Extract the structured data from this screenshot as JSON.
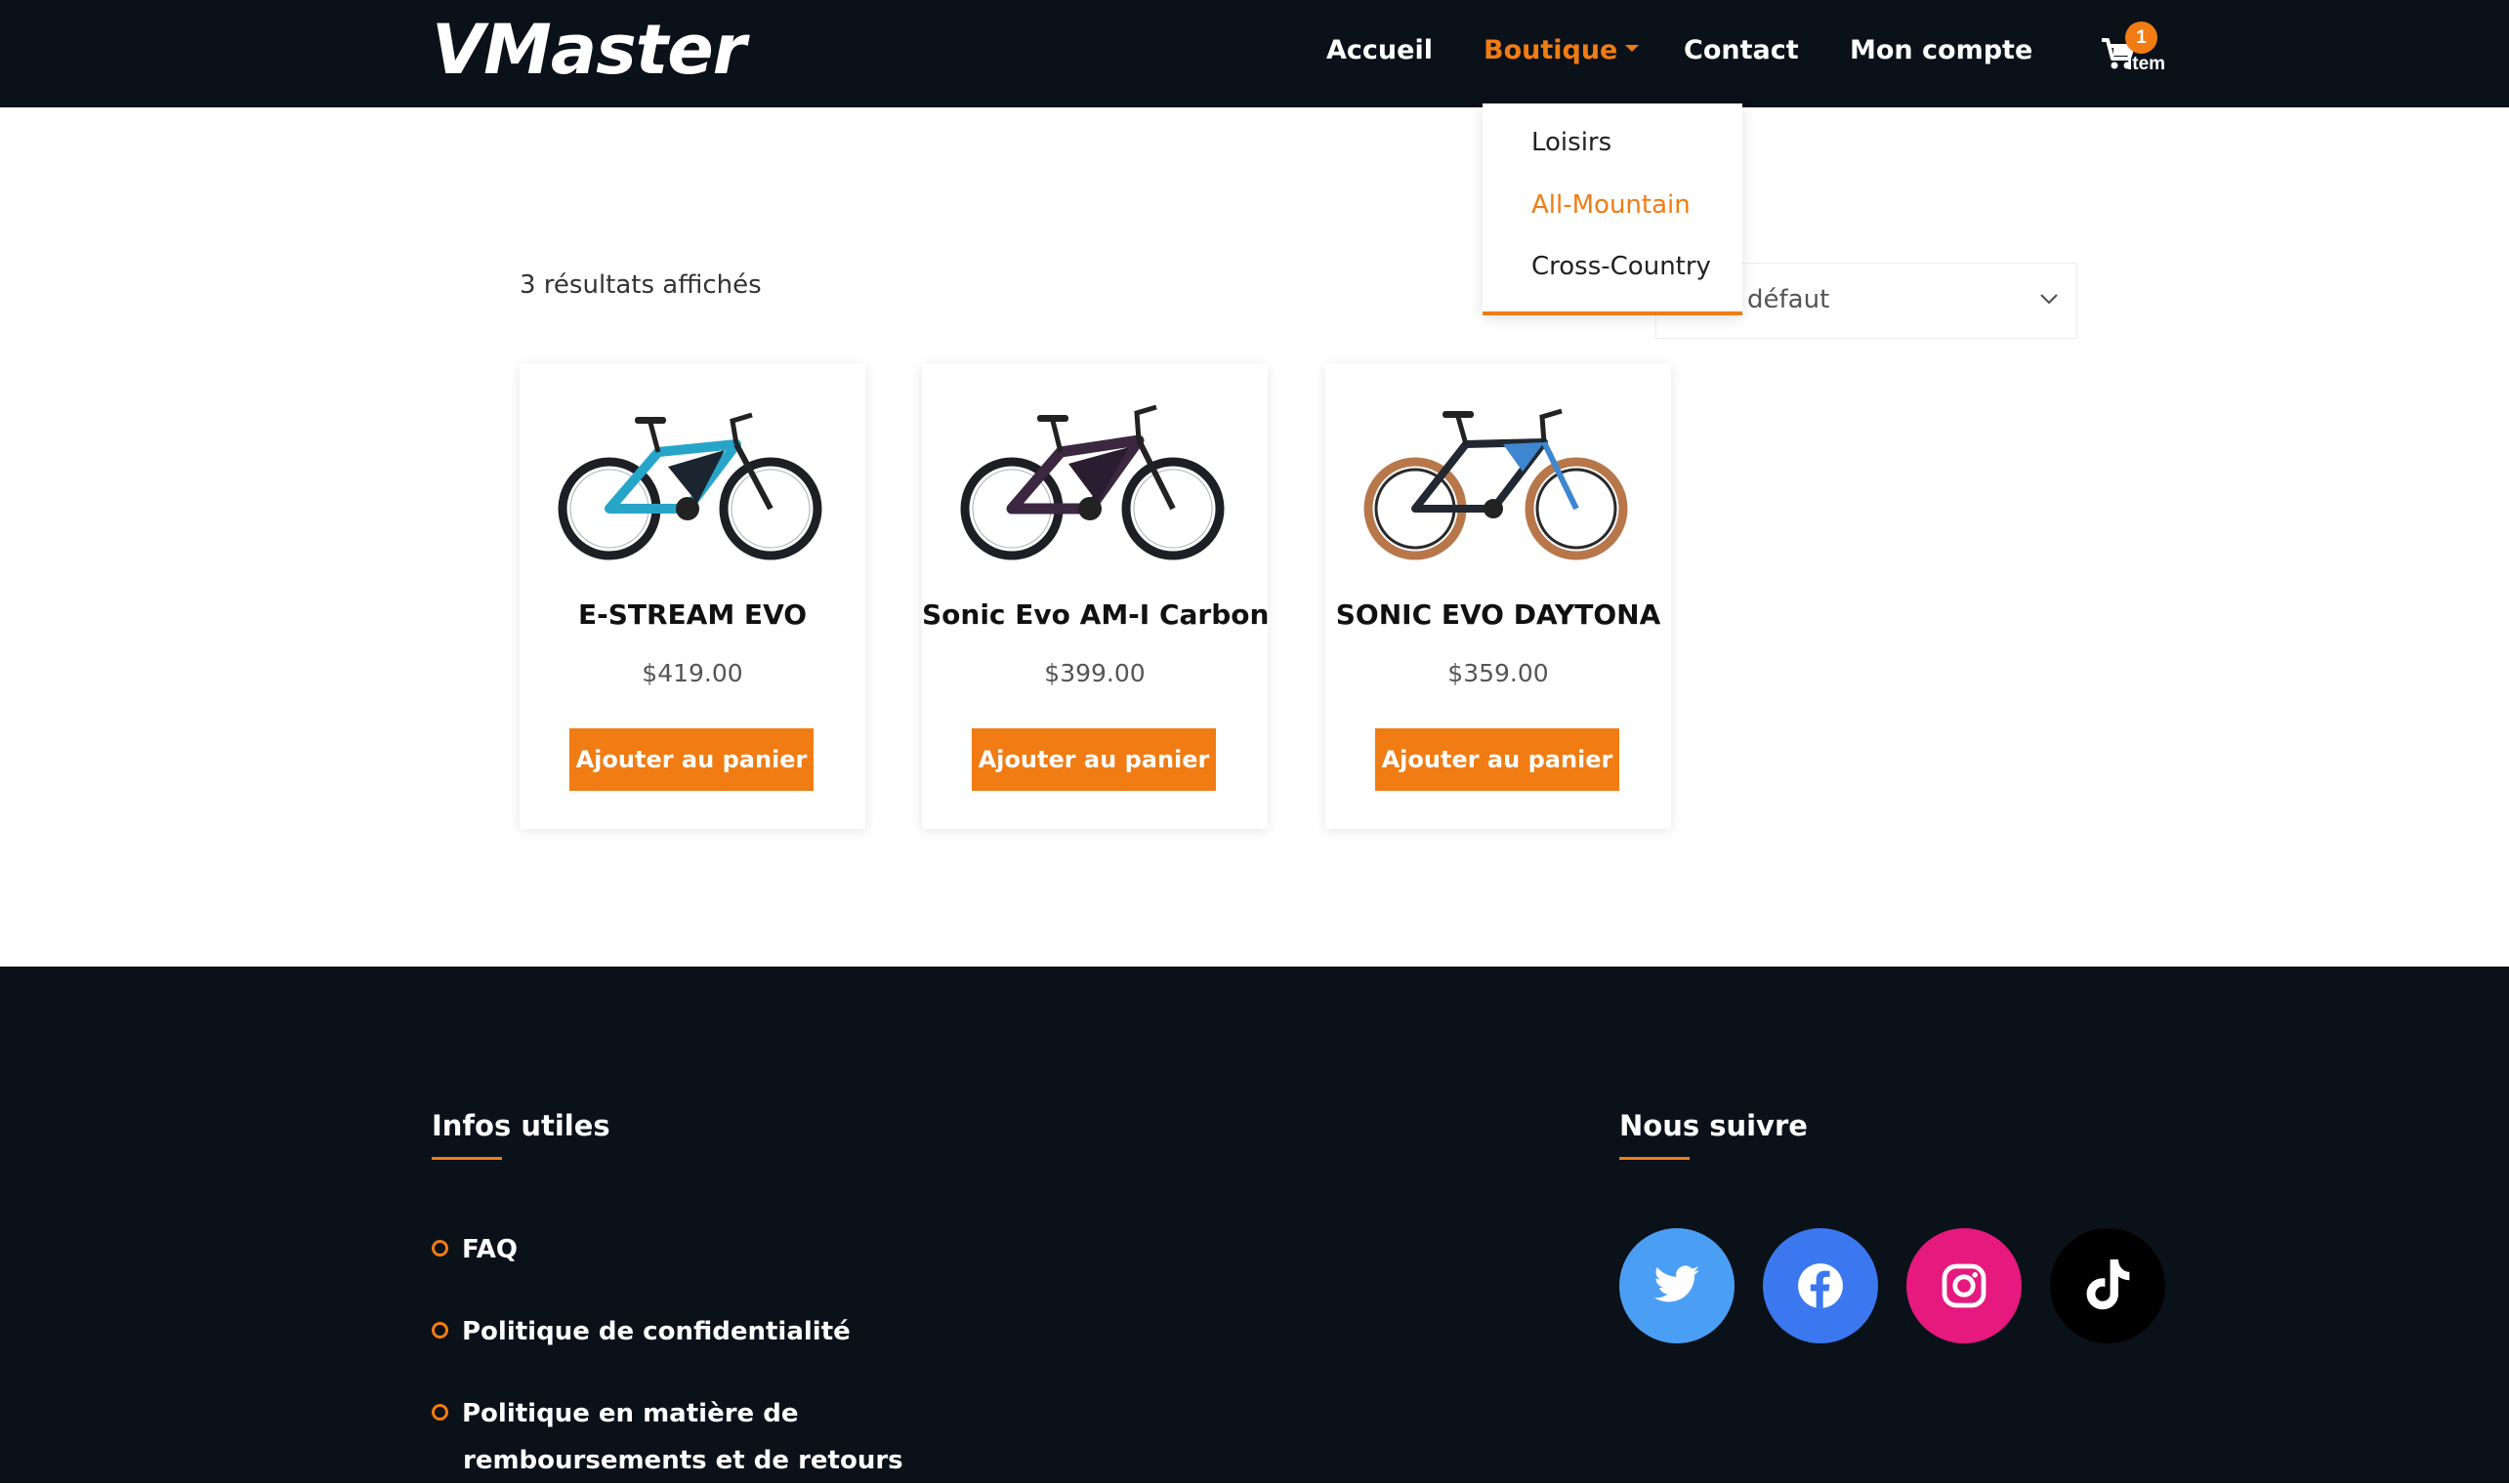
{
  "header": {
    "logo": "VMaster",
    "nav": [
      {
        "label": "Accueil"
      },
      {
        "label": "Boutique"
      },
      {
        "label": "Contact"
      },
      {
        "label": "Mon compte"
      }
    ],
    "cart": {
      "count": "1",
      "label": "Item"
    }
  },
  "dropdown": {
    "items": [
      {
        "label": "Loisirs"
      },
      {
        "label": "All-Mountain"
      },
      {
        "label": "Cross-Country"
      }
    ]
  },
  "shop": {
    "result_count": "3 résultats affichés",
    "sort_value": "défaut",
    "products": [
      {
        "title": "E-STREAM EVO",
        "price": "$419.00",
        "button": "Ajouter au panier"
      },
      {
        "title": "Sonic Evo AM-I Carbon",
        "price": "$399.00",
        "button": "Ajouter au panier"
      },
      {
        "title": "SONIC EVO DAYTONA",
        "price": "$359.00",
        "button": "Ajouter au panier"
      }
    ]
  },
  "footer": {
    "info_heading": "Infos utiles",
    "links": [
      {
        "label": "FAQ"
      },
      {
        "label": "Politique de confidentialité"
      },
      {
        "line1": "Politique en matière de",
        "line2": "remboursements et de retours"
      }
    ],
    "social_heading": "Nous suivre",
    "social": [
      {
        "icon": "twitter-icon",
        "color": "#4a9ff5"
      },
      {
        "icon": "facebook-icon",
        "color": "#3b78f0"
      },
      {
        "icon": "instagram-icon",
        "color": "#e6197e"
      },
      {
        "icon": "tiktok-icon",
        "color": "#000000"
      }
    ]
  },
  "colors": {
    "accent": "#f07c13",
    "header_bg": "#0b1119",
    "footer_bg": "#0b1119"
  }
}
